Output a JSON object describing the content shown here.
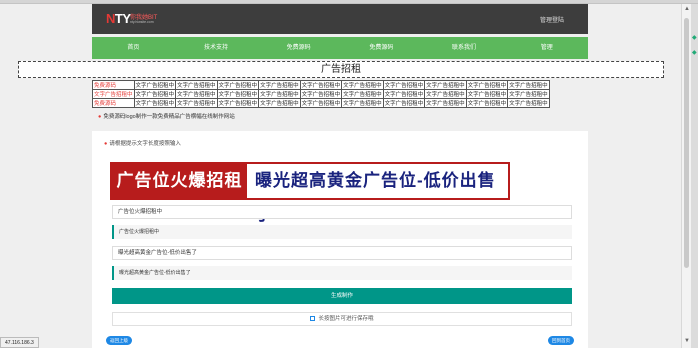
{
  "header": {
    "logo_text": "NTY",
    "logo_subtitle": "你我她BIT",
    "logo_tagline": "nty.hiwsite.com",
    "admin_link": "管理登陆"
  },
  "nav": {
    "items": [
      "首页",
      "技术支持",
      "免费源码",
      "免费源码",
      "联系我们",
      "管理"
    ]
  },
  "rent_banner": "广告招租",
  "ad_table": {
    "rows": [
      [
        "免费源码",
        "文字广告招租中",
        "文字广告招租中",
        "文字广告招租中",
        "文字广告招租中",
        "文字广告招租中",
        "文字广告招租中",
        "文字广告招租中",
        "文字广告招租中",
        "文字广告招租中",
        "文字广告招租中"
      ],
      [
        "文字广告招租中",
        "文字广告招租中",
        "文字广告招租中",
        "文字广告招租中",
        "文字广告招租中",
        "文字广告招租中",
        "文字广告招租中",
        "文字广告招租中",
        "文字广告招租中",
        "文字广告招租中",
        "文字广告招租中"
      ],
      [
        "免费源码",
        "文字广告招租中",
        "文字广告招租中",
        "文字广告招租中",
        "文字广告招租中",
        "文字广告招租中",
        "文字广告招租中",
        "文字广告招租中",
        "文字广告招租中",
        "文字广告招租中",
        "文字广告招租中"
      ]
    ],
    "red_first_col": [
      true,
      true,
      true
    ]
  },
  "notice": "免费源码logo制作一款免费精品广告横幅在线制作网站",
  "card": {
    "hint": "请根据提示文字长度按照输入",
    "banner_left": "广告位火爆招租中",
    "banner_right": "曝光超高黄金广告位-低价出售了",
    "input1_value": "广告位火爆招租中",
    "quote1": "广告位火爆招租中",
    "input2_value": "曝光超高黄金广告位-低价出售了",
    "quote2": "曝光超高黄金广告位-低价出售了",
    "generate_button": "生成制作",
    "save_tip": "长按图片可进行保存哦",
    "prev_button": "返回上级",
    "home_button": "回到首页"
  },
  "status_bar": "47.116.186.3",
  "colors": {
    "header_bg": "#3d3d3d",
    "nav_bg": "#5cb85c",
    "banner_red": "#b71c1c",
    "banner_blue": "#1a237e",
    "teal_button": "#009688",
    "pill_blue": "#1e88e5",
    "ad_red_text": "#e53935"
  }
}
